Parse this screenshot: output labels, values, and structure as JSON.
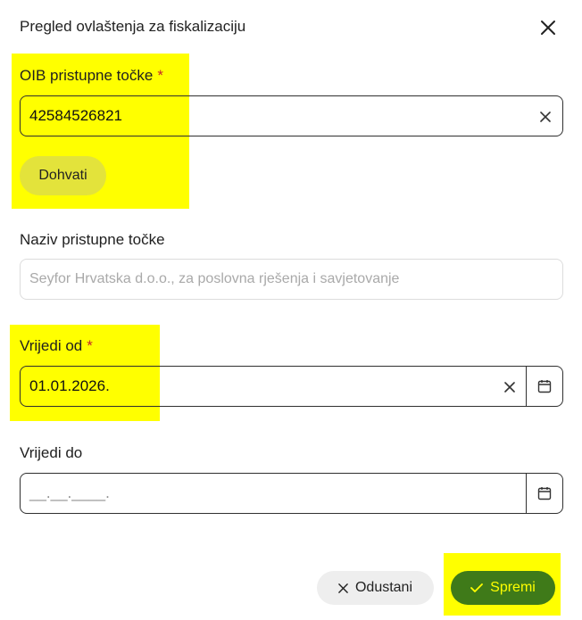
{
  "dialog": {
    "title": "Pregled ovlaštenja za fiskalizaciju"
  },
  "oib": {
    "label": "OIB pristupne točke",
    "required_mark": "*",
    "value": "42584526821",
    "fetch_label": "Dohvati"
  },
  "naziv": {
    "label": "Naziv pristupne točke",
    "placeholder": "Seyfor Hrvatska d.o.o., za poslovna rješenja i savjetovanje"
  },
  "valid_from": {
    "label": "Vrijedi od",
    "required_mark": "*",
    "value": "01.01.2026."
  },
  "valid_to": {
    "label": "Vrijedi do",
    "mask": "__.__.____."
  },
  "footer": {
    "cancel_label": "Odustani",
    "save_label": "Spremi"
  },
  "colors": {
    "highlight": "#ffff00",
    "save_button": "#3f7a19",
    "required": "#c62828"
  }
}
